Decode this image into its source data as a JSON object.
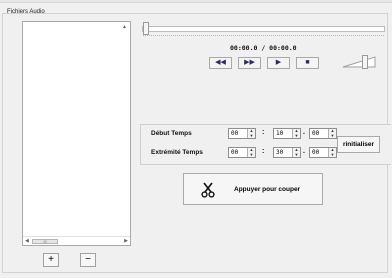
{
  "group": {
    "title": "Fichiers Audio"
  },
  "player": {
    "time_current": "00:00.0",
    "time_separator": "/",
    "time_total": "00:00.0",
    "controls": [
      {
        "name": "rewind",
        "glyph": "◀◀"
      },
      {
        "name": "fast-forward",
        "glyph": "▶▶"
      },
      {
        "name": "play",
        "glyph": "▶"
      },
      {
        "name": "stop",
        "glyph": "■"
      }
    ],
    "seek_fraction": 0.0,
    "volume_fraction": 0.7
  },
  "cut": {
    "start_label": "Début Temps",
    "end_label": "Extrémité Temps",
    "start": {
      "min": "00",
      "sec": "10",
      "tenth": "00"
    },
    "end": {
      "min": "00",
      "sec": "30",
      "tenth": "00"
    },
    "colon": ":",
    "dot": ".",
    "reset_label": "r‍initialiser",
    "cut_label": "Appuyer pour couper"
  },
  "list": {
    "add_label": "+",
    "remove_label": "−",
    "scroll_thumb": "III"
  }
}
